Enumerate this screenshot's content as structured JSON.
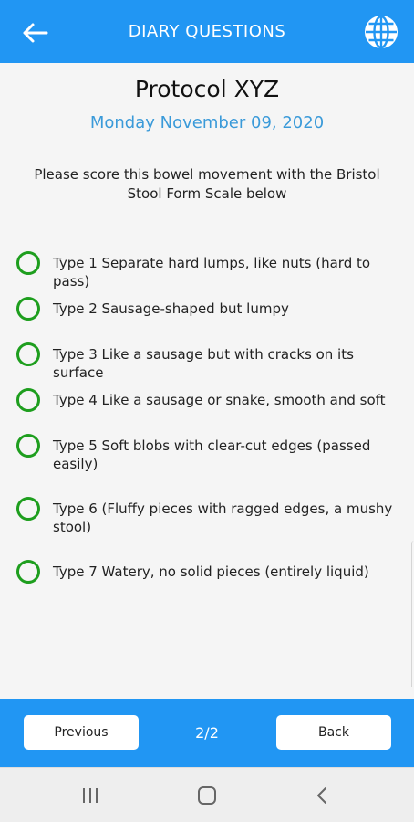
{
  "header": {
    "title": "DIARY QUESTIONS",
    "back_icon": "arrow-left-icon",
    "language_icon": "globe-icon",
    "color": "#2196f3"
  },
  "main": {
    "protocol": "Protocol XYZ",
    "date": "Monday November 09, 2020",
    "question": "Please score this bowel movement with the Bristol Stool Form Scale below",
    "options": [
      "Type 1 Separate hard lumps, like nuts (hard to pass)",
      "Type 2 Sausage-shaped but lumpy",
      "Type 3 Like a sausage but with cracks on its surface",
      "Type 4 Like a sausage or snake, smooth and soft",
      "Type 5 Soft blobs with clear-cut edges (passed easily)",
      "Type 6 (Fluffy pieces with ragged edges, a mushy stool)",
      "Type 7 Watery, no solid pieces (entirely liquid)"
    ],
    "radio_color": "#1e9e1e",
    "date_color": "#3a9ad9"
  },
  "footer": {
    "previous_label": "Previous",
    "page_indicator": "2/2",
    "back_label": "Back"
  },
  "system_nav": {
    "recents_icon": "recents-icon",
    "home_icon": "home-icon",
    "back_icon": "chevron-left-icon"
  }
}
